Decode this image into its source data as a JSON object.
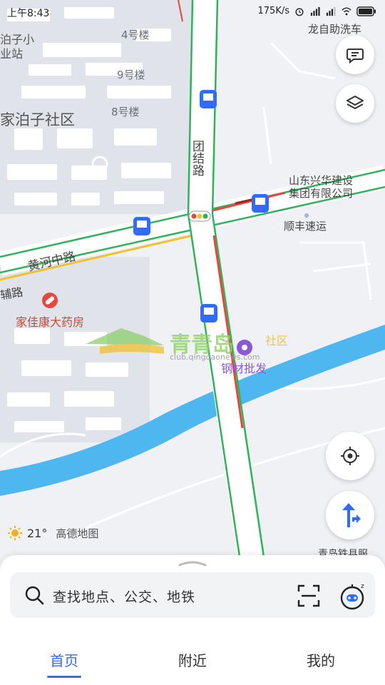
{
  "status_bar": {
    "time": "上午8:43",
    "net_speed": "175K/s"
  },
  "map": {
    "labels": {
      "building_4": "4号楼",
      "building_9": "9号楼",
      "building_8": "8号楼",
      "community_partial_1": "泊子小",
      "community_partial_2": "业站",
      "community": "家泊子社区",
      "tuanjie_road": "团结路",
      "huanghe_road": "黄河中路",
      "side_road": "辅路",
      "pharmacy": "家佳康大药房",
      "company_line1": "山东兴华建设",
      "company_line2": "集团有限公司",
      "sf_express": "顺丰速运",
      "steel": "钢材批发",
      "carwash": "龙自助洗车",
      "station": "青岛铁县服",
      "watermark_cn": "青青岛",
      "watermark_community": "社区",
      "watermark_url": "club.qingdaonews.com"
    }
  },
  "weather": {
    "temperature": "21°",
    "brand": "高德地图"
  },
  "search": {
    "placeholder": "查找地点、公交、地铁"
  },
  "tabs": [
    {
      "label": "首页",
      "active": true
    },
    {
      "label": "附近",
      "active": false
    },
    {
      "label": "我的",
      "active": false
    }
  ],
  "colors": {
    "accent": "#2f6bff",
    "traffic_green": "#2fb35a",
    "traffic_red": "#e8473e",
    "traffic_yellow": "#f2c12e",
    "river": "#4fb7f0"
  }
}
